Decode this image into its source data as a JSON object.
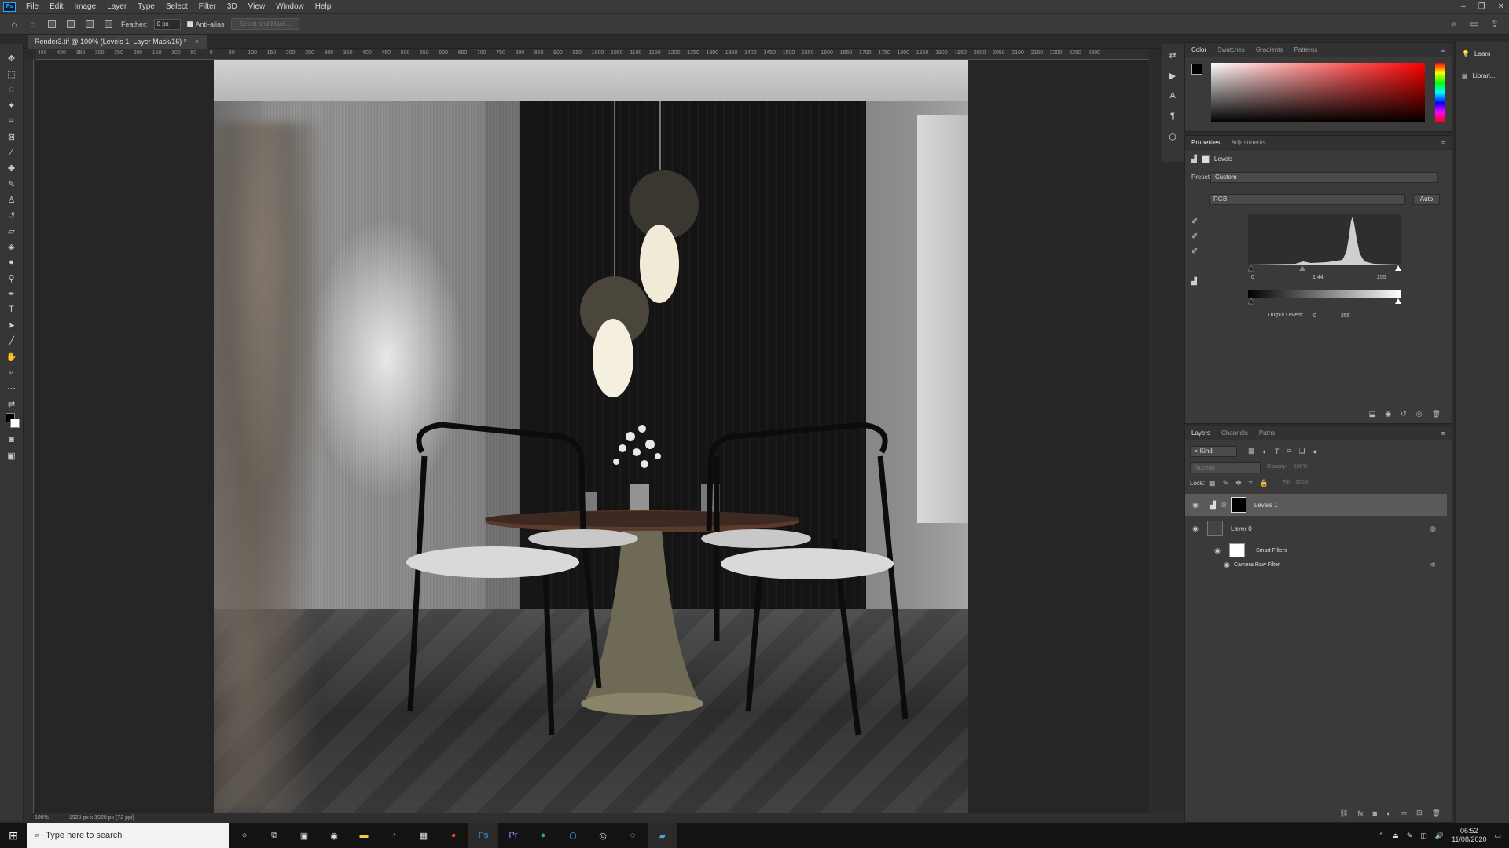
{
  "menu": {
    "app_icon": "Ps",
    "items": [
      "File",
      "Edit",
      "Image",
      "Layer",
      "Type",
      "Select",
      "Filter",
      "3D",
      "View",
      "Window",
      "Help"
    ]
  },
  "options": {
    "feather_label": "Feather:",
    "feather_value": "0 px",
    "antialias_label": "Anti-alias",
    "select_mask_label": "Select and Mask..."
  },
  "document": {
    "tab_title": "Render3.tif @ 100% (Levels 1, Layer Mask/16) *",
    "close": "×"
  },
  "ruler_h": [
    "450",
    "400",
    "350",
    "300",
    "250",
    "200",
    "150",
    "100",
    "50",
    "0",
    "50",
    "100",
    "150",
    "200",
    "250",
    "300",
    "350",
    "400",
    "450",
    "500",
    "550",
    "600",
    "650",
    "700",
    "750",
    "800",
    "850",
    "900",
    "950",
    "1000",
    "1050",
    "1100",
    "1150",
    "1200",
    "1250",
    "1300",
    "1350",
    "1400",
    "1450",
    "1500",
    "1550",
    "1600",
    "1650",
    "1700",
    "1750",
    "1800",
    "1850",
    "1900",
    "1950",
    "2000",
    "2050",
    "2100",
    "2150",
    "2200",
    "2250",
    "2300"
  ],
  "color_panel": {
    "tabs": [
      "Color",
      "Swatches",
      "Gradients",
      "Patterns"
    ],
    "active": "Color"
  },
  "properties_panel": {
    "tabs": [
      "Properties",
      "Adjustments"
    ],
    "active": "Properties",
    "adjustment_name": "Levels",
    "preset_label": "Preset:",
    "preset_value": "Custom",
    "channel_value": "RGB",
    "auto_label": "Auto",
    "input_black": "0",
    "input_gamma": "1.44",
    "input_white": "255",
    "output_label": "Output Levels:",
    "output_black": "0",
    "output_white": "255"
  },
  "layers_panel": {
    "tabs": [
      "Layers",
      "Channels",
      "Paths"
    ],
    "active": "Layers",
    "kind_label": "Kind",
    "blend_mode": "Normal",
    "opacity_label": "Opacity:",
    "opacity_value": "100%",
    "lock_label": "Lock:",
    "fill_label": "Fill:",
    "fill_value": "100%",
    "layers": [
      {
        "name": "Levels 1"
      },
      {
        "name": "Layer 0"
      },
      {
        "name": "Smart Filters"
      },
      {
        "name": "Camera Raw Filter"
      }
    ]
  },
  "learn_panel": {
    "items": [
      "Learn",
      "Librari..."
    ]
  },
  "status": {
    "zoom": "100%",
    "doc_info": "1920 px x 1920 px (72 ppi)"
  },
  "taskbar": {
    "search_placeholder": "Type here to search",
    "time": "06:52",
    "date": "11/08/2020"
  },
  "colors": {
    "ui_bg": "#2b2b2b",
    "panel_bg": "#3a3a3a",
    "accent": "#31a8ff"
  }
}
